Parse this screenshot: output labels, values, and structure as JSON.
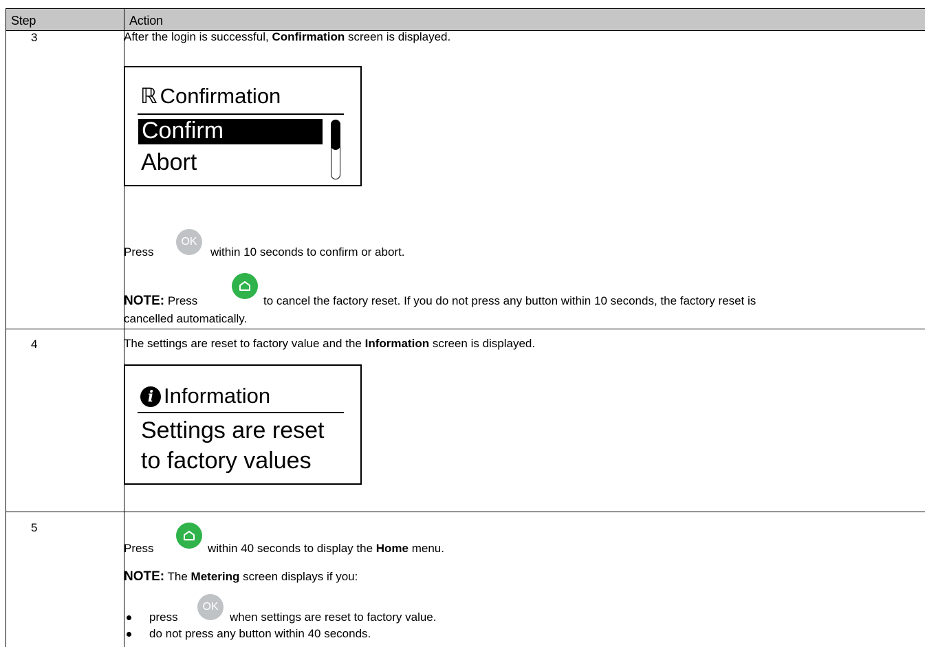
{
  "header": {
    "step_label": "Step",
    "action_label": "Action"
  },
  "rows": [
    {
      "step": "3",
      "intro_before": "After the login is successful, ",
      "intro_bold": "Confirmation",
      "intro_after": " screen is displayed.",
      "screen": {
        "title": "Confirmation",
        "title_glyph": "ℝ",
        "selected_item": "Confirm",
        "items": [
          "Abort"
        ],
        "scrollbar": "scrollbar"
      },
      "press_prefix": "Press",
      "press_button": "OK",
      "press_suffix": "within 10 seconds to confirm or abort.",
      "note_label": "NOTE:",
      "note_press": "Press",
      "note_text_1": "to cancel the factory reset. If you do not press any button within 10 seconds, the factory reset is",
      "note_text_2": "cancelled automatically."
    },
    {
      "step": "4",
      "intro_before": "The settings are reset to factory value and the ",
      "intro_bold": "Information",
      "intro_after": " screen is displayed.",
      "screen": {
        "title": "Information",
        "lines": [
          "Settings are reset",
          "to factory values"
        ]
      }
    },
    {
      "step": "5",
      "press_prefix": "Press",
      "press_suffix_before": "within 40 seconds to display the ",
      "press_bold": "Home",
      "press_suffix_after": " menu.",
      "note_label": "NOTE:",
      "note_before": " The ",
      "note_bold": "Metering",
      "note_after": " screen displays if you:",
      "bullets": [
        {
          "prefix": "press",
          "button": "OK",
          "suffix": "when settings are reset to factory value."
        },
        {
          "text": "do not press any button within 40 seconds."
        }
      ]
    }
  ],
  "icons": {
    "ok": "ok-button-icon",
    "home": "home-button-icon",
    "info": "info-icon"
  },
  "colors": {
    "header_bg": "#c6c6c6",
    "ok_button": "#bfc3c6",
    "home_button": "#2fb34a"
  }
}
